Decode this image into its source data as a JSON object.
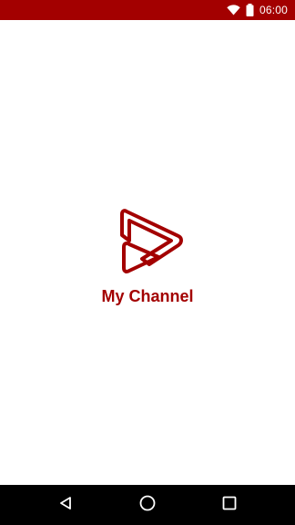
{
  "status_bar": {
    "time": "06:00",
    "background_color": "#a30000",
    "icons": [
      "wifi-icon",
      "battery-icon"
    ]
  },
  "splash": {
    "logo": "play-logo-icon",
    "app_name": "My Channel",
    "accent_color": "#a30000"
  },
  "nav_bar": {
    "buttons": [
      "back-icon",
      "home-icon",
      "recents-icon"
    ]
  }
}
